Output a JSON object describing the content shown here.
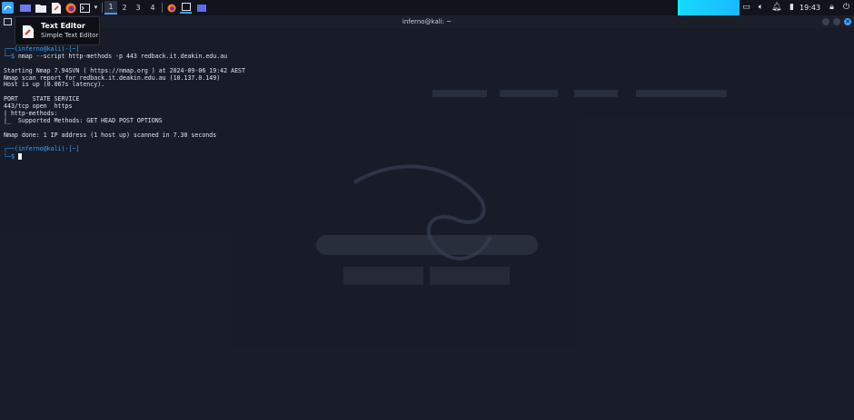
{
  "panel": {
    "workspaces": [
      "1",
      "2",
      "3",
      "4"
    ],
    "active_workspace": "1",
    "clock": "19:43",
    "icons": [
      "kali-menu-icon",
      "workspace-switch-icon",
      "files-icon",
      "text-editor-icon",
      "firefox-icon",
      "terminal-icon",
      "terminal-dropdown-icon",
      "firefox-window-icon",
      "terminal-window-icon",
      "app-window-icon",
      "display-icon",
      "volume-icon",
      "notifications-icon",
      "battery-icon",
      "lock-icon",
      "power-icon"
    ]
  },
  "terminal": {
    "title": "inferno@kali: ~",
    "prompt1": {
      "user": "inferno@kali",
      "path": "~",
      "command": "nmap --script http-methods -p 443 redback.it.deakin.edu.au"
    },
    "output": [
      "",
      "Starting Nmap 7.94SVN ( https://nmap.org ) at 2024-09-06 19:42 AEST",
      "Nmap scan report for redback.it.deakin.edu.au (10.137.0.149)",
      "Host is up (0.067s latency).",
      "",
      "PORT    STATE SERVICE",
      "443/tcp open  https",
      "| http-methods:",
      "|_  Supported Methods: GET HEAD POST OPTIONS",
      "",
      "Nmap done: 1 IP address (1 host up) scanned in 7.30 seconds",
      ""
    ],
    "prompt2": {
      "user": "inferno@kali",
      "path": "~"
    }
  },
  "tooltip": {
    "title": "Text Editor",
    "subtitle": "Simple Text Editor"
  },
  "colors": {
    "accent": "#3aa3ff",
    "panel_bg": "#11141c",
    "terminal_bg": "#1c2130",
    "cyan_indicator": "#16d8ff"
  }
}
